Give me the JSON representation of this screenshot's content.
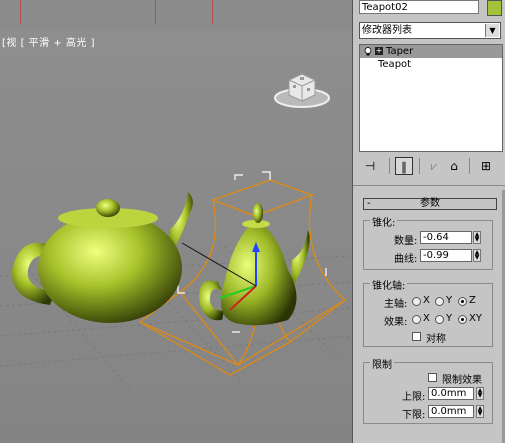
{
  "viewport": {
    "label": "[视 [ 平滑 + 高光 ]"
  },
  "panel": {
    "object_name": "Teapot02",
    "object_color": "#a6c23a",
    "modifier_list": "修改器列表",
    "stack": [
      {
        "label": "Taper",
        "selected": true
      },
      {
        "label": "Teapot",
        "selected": false
      }
    ],
    "params": {
      "rollout_title": "参数",
      "taper": {
        "title": "锥化:",
        "amount_label": "数量:",
        "amount_value": "-0.64",
        "curve_label": "曲线:",
        "curve_value": "-0.99"
      },
      "axis": {
        "title": "锥化轴:",
        "primary_label": "主轴:",
        "effect_label": "效果:",
        "primary_options": [
          "X",
          "Y",
          "Z"
        ],
        "effect_options": [
          "X",
          "Y",
          "XY"
        ],
        "primary_selected": "Z",
        "effect_selected": "XY",
        "symmetry_label": "对称"
      },
      "limits": {
        "title": "限制",
        "limit_effect_label": "限制效果",
        "upper_label": "上限:",
        "upper_value": "0.0mm",
        "lower_label": "下限:",
        "lower_value": "0.0mm"
      }
    }
  }
}
